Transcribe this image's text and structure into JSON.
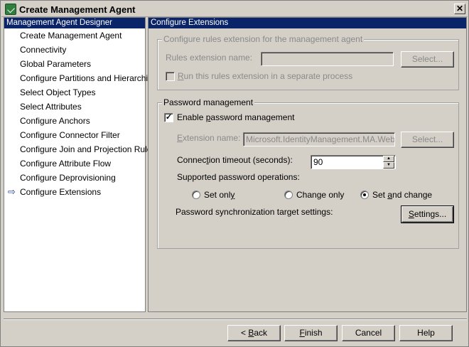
{
  "window": {
    "title": "Create Management Agent",
    "close_glyph": "✕"
  },
  "left": {
    "header": "Management Agent Designer",
    "items": [
      {
        "label": "Create Management Agent",
        "current": false
      },
      {
        "label": "Connectivity",
        "current": false
      },
      {
        "label": "Global Parameters",
        "current": false
      },
      {
        "label": "Configure Partitions and Hierarchies",
        "current": false
      },
      {
        "label": "Select Object Types",
        "current": false
      },
      {
        "label": "Select Attributes",
        "current": false
      },
      {
        "label": "Configure Anchors",
        "current": false
      },
      {
        "label": "Configure Connector Filter",
        "current": false
      },
      {
        "label": "Configure Join and Projection Rules",
        "current": false
      },
      {
        "label": "Configure Attribute Flow",
        "current": false
      },
      {
        "label": "Configure Deprovisioning",
        "current": false
      },
      {
        "label": "Configure Extensions",
        "current": true
      }
    ],
    "current_icon": "arrow-right-icon"
  },
  "right": {
    "header": "Configure Extensions",
    "rules": {
      "legend": "Configure rules extension for the management agent",
      "name_label": "Rules extension name:",
      "name_value": "",
      "select_button": "Select...",
      "separate_process_label": "Run this rules extension in a separate process",
      "separate_process_checked": false
    },
    "password": {
      "legend": "Password management",
      "enable_label": "Enable password management",
      "enable_checked": true,
      "extension_label": "Extension name:",
      "extension_value": "Microsoft.IdentityManagement.MA.WebServ",
      "extension_select_button": "Select...",
      "timeout_label": "Connection timeout (seconds):",
      "timeout_value": "90",
      "ops_label": "Supported password operations:",
      "ops": [
        {
          "label": "Set only",
          "selected": false
        },
        {
          "label": "Change only",
          "selected": false
        },
        {
          "label": "Set and change",
          "selected": true
        }
      ],
      "sync_label": "Password synchronization target settings:",
      "settings_button": "Settings..."
    }
  },
  "footer": {
    "back": "< Back",
    "finish": "Finish",
    "cancel": "Cancel",
    "help": "Help"
  }
}
